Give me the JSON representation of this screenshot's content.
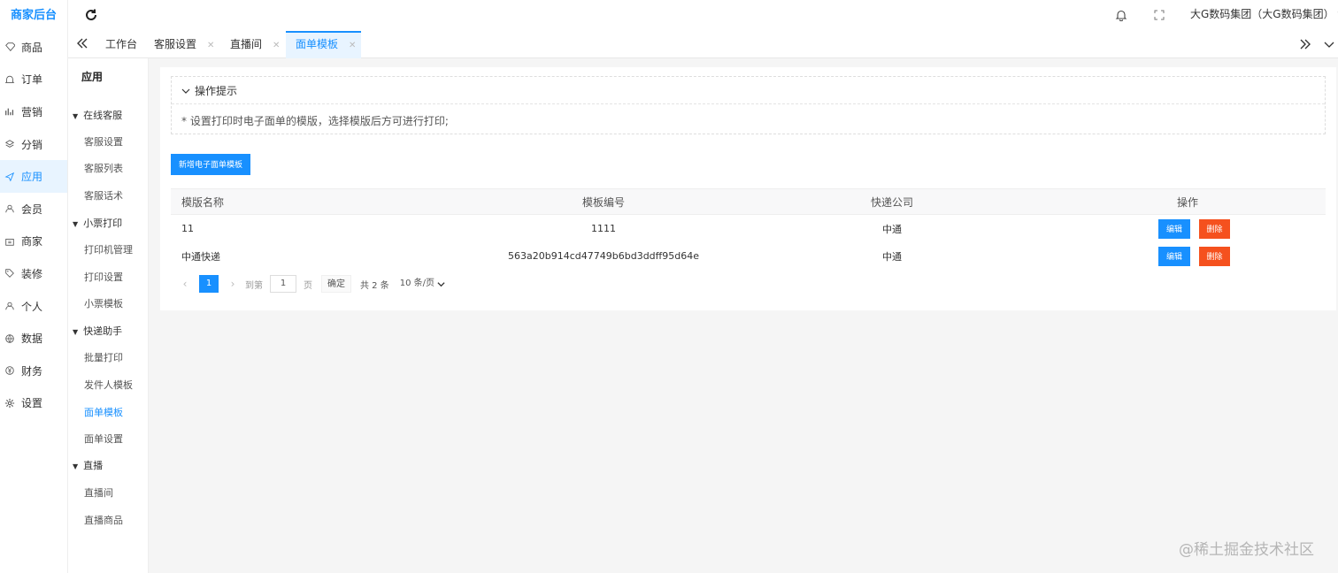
{
  "brand": "商家后台",
  "main_nav": [
    {
      "label": "商品",
      "icon": "diamond-icon"
    },
    {
      "label": "订单",
      "icon": "bell-icon"
    },
    {
      "label": "营销",
      "icon": "chart-icon"
    },
    {
      "label": "分销",
      "icon": "layers-icon"
    },
    {
      "label": "应用",
      "icon": "send-icon"
    },
    {
      "label": "会员",
      "icon": "user-icon"
    },
    {
      "label": "商家",
      "icon": "store-icon"
    },
    {
      "label": "装修",
      "icon": "tag-icon"
    },
    {
      "label": "个人",
      "icon": "person-icon"
    },
    {
      "label": "数据",
      "icon": "globe-icon"
    },
    {
      "label": "财务",
      "icon": "yen-icon"
    },
    {
      "label": "设置",
      "icon": "gear-icon"
    }
  ],
  "header": {
    "user": "大G数码集团（大G数码集团）"
  },
  "tabs": [
    {
      "label": "工作台"
    },
    {
      "label": "客服设置"
    },
    {
      "label": "直播间"
    },
    {
      "label": "面单模板"
    }
  ],
  "sub_sidebar": {
    "title": "应用",
    "groups": [
      {
        "label": "在线客服",
        "items": [
          "客服设置",
          "客服列表",
          "客服话术"
        ]
      },
      {
        "label": "小票打印",
        "items": [
          "打印机管理",
          "打印设置",
          "小票模板"
        ]
      },
      {
        "label": "快递助手",
        "items": [
          "批量打印",
          "发件人模板",
          "面单模板",
          "面单设置"
        ]
      },
      {
        "label": "直播",
        "items": [
          "直播间",
          "直播商品"
        ]
      }
    ]
  },
  "tip": {
    "title": "操作提示",
    "body": "* 设置打印时电子面单的模版，选择模版后方可进行打印;"
  },
  "new_button": "新增电子面单模板",
  "table": {
    "headers": [
      "模版名称",
      "模板编号",
      "快递公司",
      "操作"
    ],
    "rows": [
      {
        "name": "11",
        "code": "1111",
        "corp": "中通"
      },
      {
        "name": "中通快递",
        "code": "563a20b914cd47749b6bd3ddff95d64e",
        "corp": "中通"
      }
    ],
    "edit_label": "编辑",
    "delete_label": "删除"
  },
  "pager": {
    "current": "1",
    "goto_label": "到第",
    "input_value": "1",
    "page_label": "页",
    "confirm": "确定",
    "total": "共 2 条",
    "size": "10 条/页"
  },
  "watermark": "@稀土掘金技术社区"
}
